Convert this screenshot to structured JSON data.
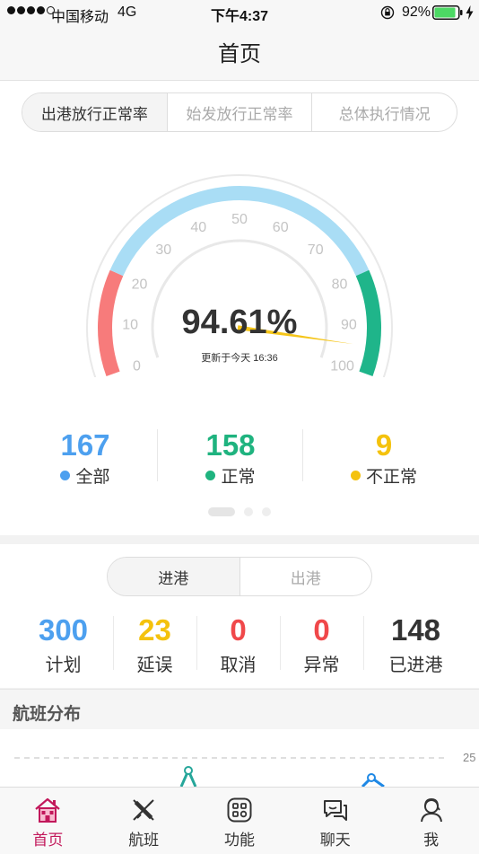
{
  "status_bar": {
    "carrier": "中国移动",
    "network": "4G",
    "time": "下午4:37",
    "battery": "92%",
    "battery_level": 0.92
  },
  "header": {
    "title": "首页"
  },
  "rate_tabs": [
    {
      "label": "出港放行正常率",
      "active": true
    },
    {
      "label": "始发放行正常率",
      "active": false
    },
    {
      "label": "总体执行情况",
      "active": false
    }
  ],
  "gauge": {
    "value": 94.61,
    "value_text": "94.61%",
    "updated": "更新于今天 16:36",
    "ticks": [
      "0",
      "10",
      "20",
      "30",
      "40",
      "50",
      "60",
      "70",
      "80",
      "90",
      "100"
    ],
    "bands": [
      {
        "from": 0,
        "to": 20,
        "color": "#f77b7b"
      },
      {
        "from": 20,
        "to": 80,
        "color": "#a9ddf5"
      },
      {
        "from": 80,
        "to": 100,
        "color": "#1fb58a"
      }
    ],
    "needle_color": "#f5c518"
  },
  "summary": [
    {
      "value": "167",
      "label": "全部",
      "color": "#4da0ef"
    },
    {
      "value": "158",
      "label": "正常",
      "color": "#1fb37f"
    },
    {
      "value": "9",
      "label": "不正常",
      "color": "#f4c20d"
    }
  ],
  "io_tabs": [
    {
      "label": "进港",
      "active": true
    },
    {
      "label": "出港",
      "active": false
    }
  ],
  "flight_stats": [
    {
      "value": "300",
      "label": "计划",
      "color": "#4da0ef"
    },
    {
      "value": "23",
      "label": "延误",
      "color": "#f4c20d"
    },
    {
      "value": "0",
      "label": "取消",
      "color": "#f0484a"
    },
    {
      "value": "0",
      "label": "异常",
      "color": "#f0484a"
    },
    {
      "value": "148",
      "label": "已进港",
      "color": "#333333"
    }
  ],
  "distribution": {
    "title": "航班分布",
    "tick": "25"
  },
  "tab_bar": [
    {
      "label": "首页",
      "icon": "home-icon",
      "active": true
    },
    {
      "label": "航班",
      "icon": "flight-icon",
      "active": false
    },
    {
      "label": "功能",
      "icon": "function-icon",
      "active": false
    },
    {
      "label": "聊天",
      "icon": "chat-icon",
      "active": false
    },
    {
      "label": "我",
      "icon": "user-icon",
      "active": false
    }
  ],
  "colors": {
    "accent": "#c2185b"
  }
}
